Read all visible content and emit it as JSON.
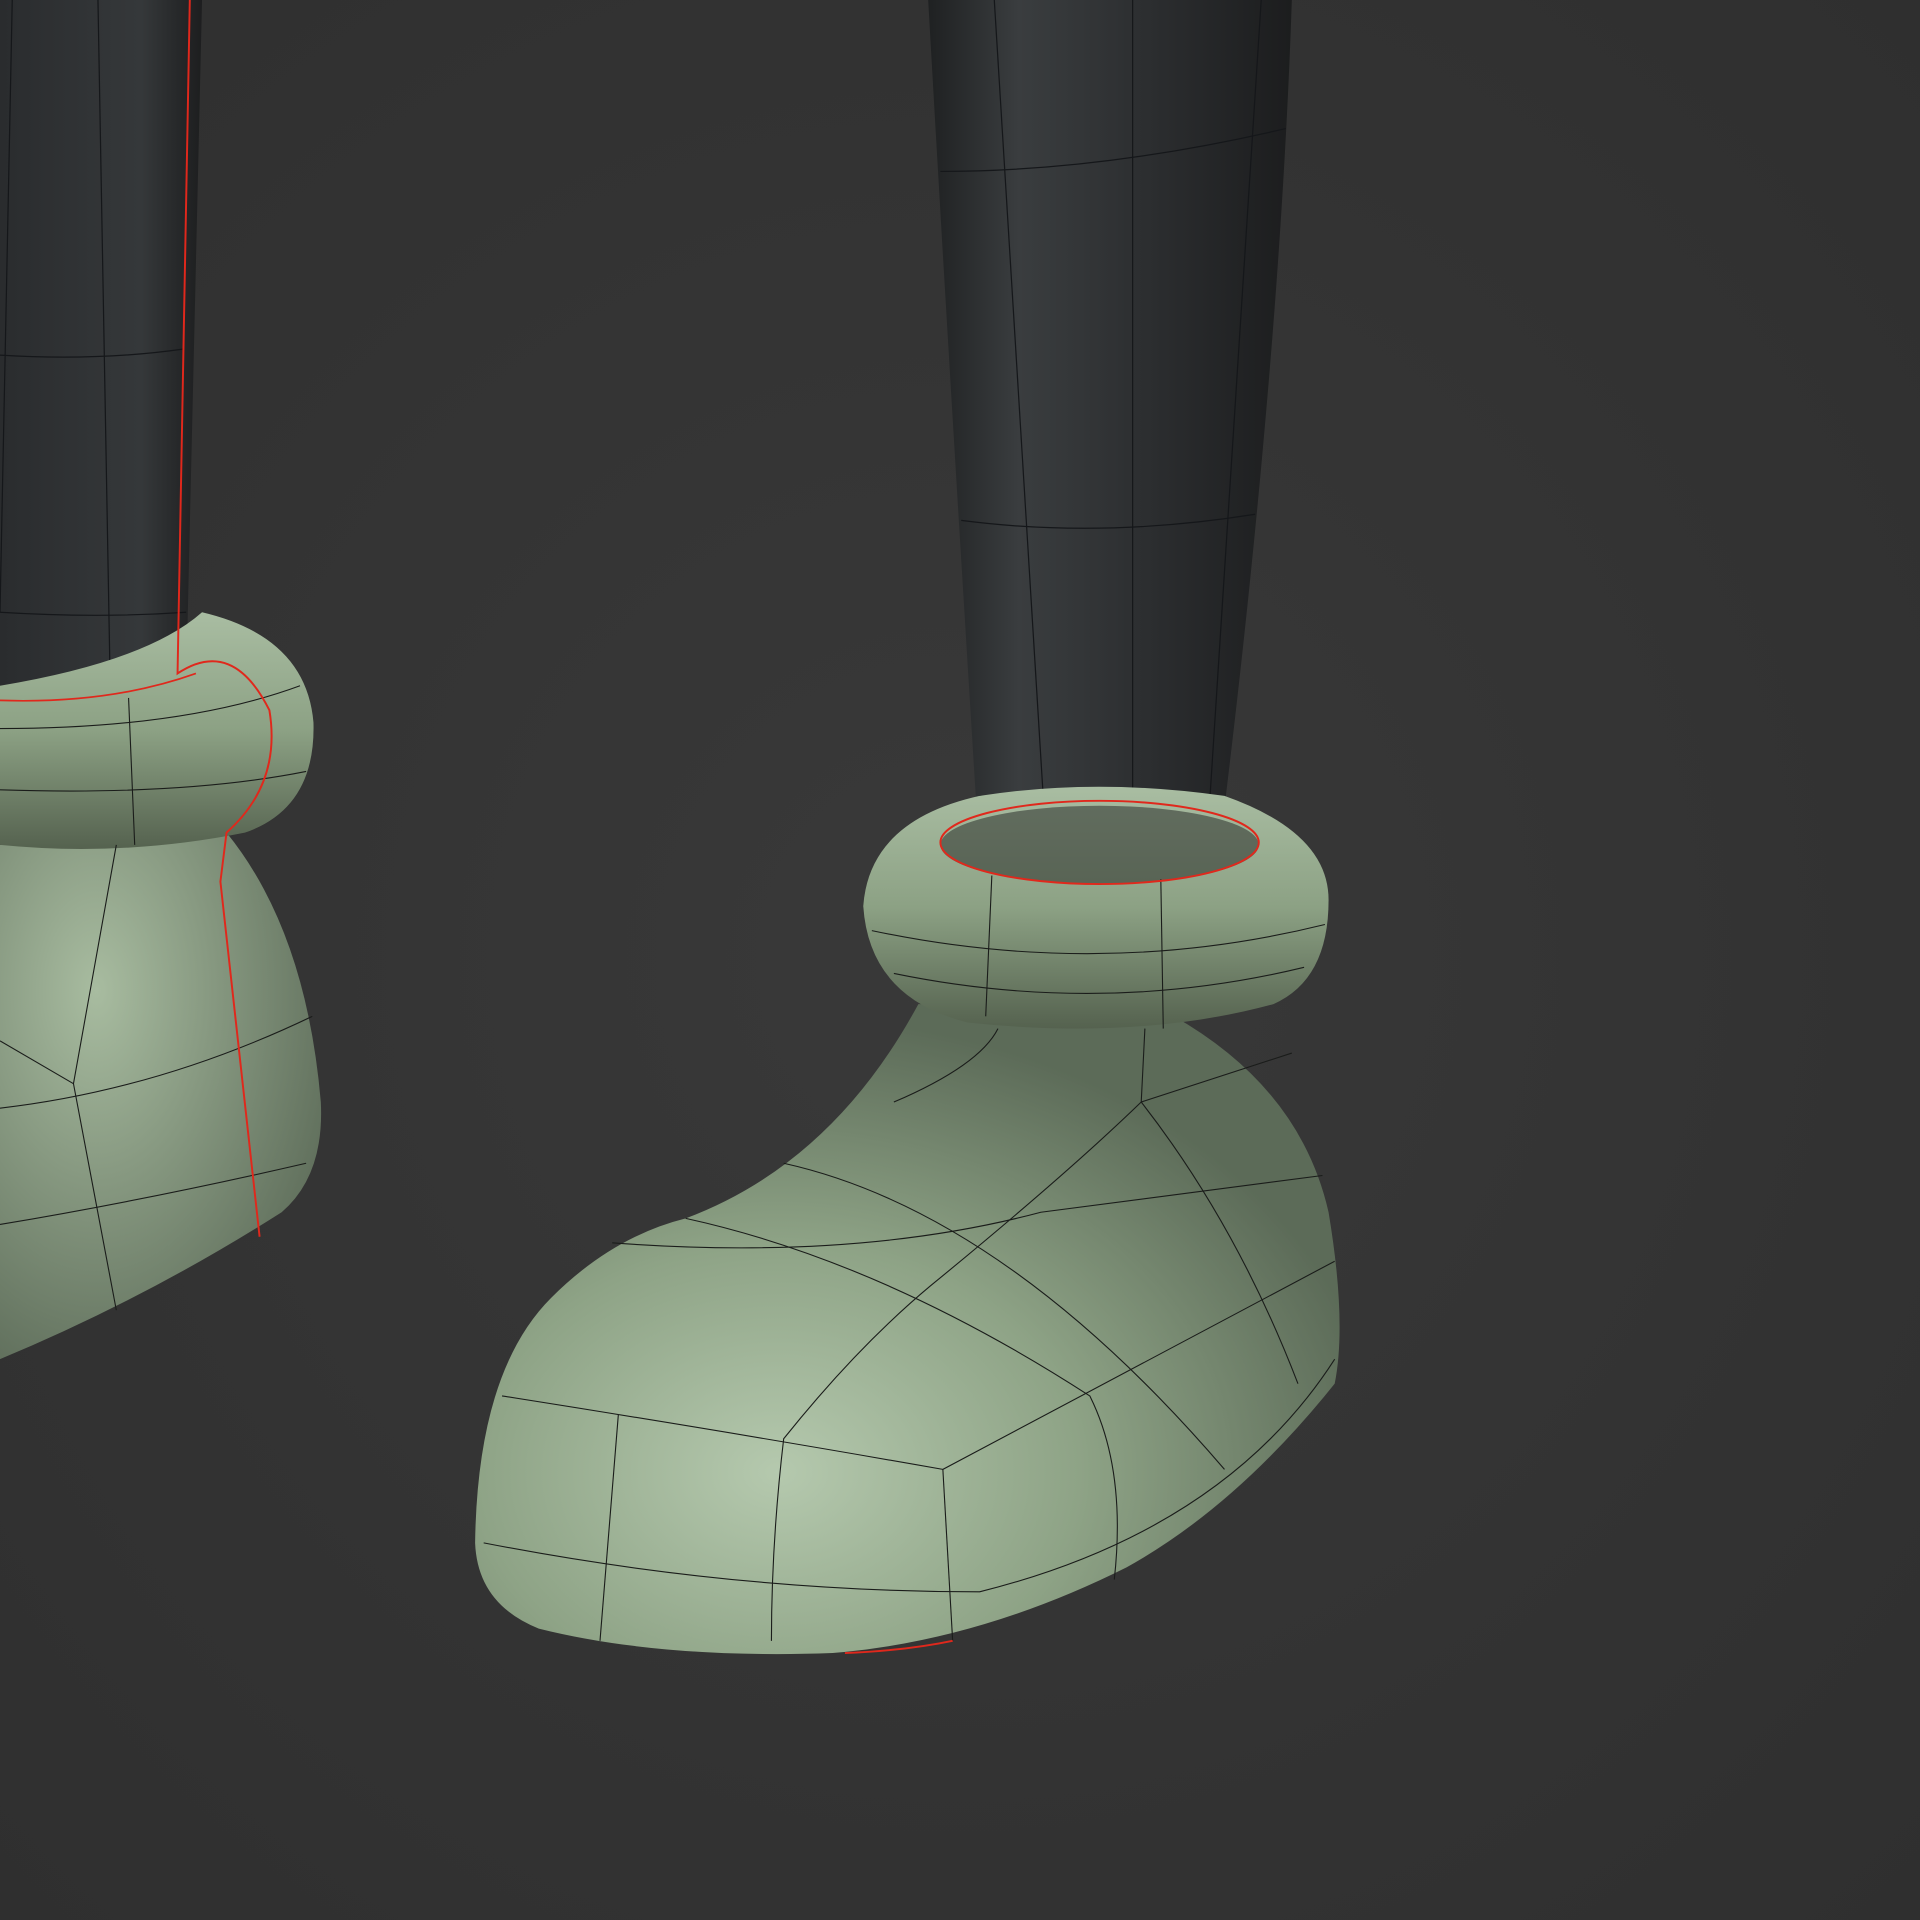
{
  "scene": {
    "background_color": "#343434",
    "leg_color": "#2e3032",
    "boot_color": "#8fa488",
    "boot_highlight_color": "#b7cbb0",
    "wire_color": "#1a1c1a",
    "seam_color": "#e0281c"
  }
}
